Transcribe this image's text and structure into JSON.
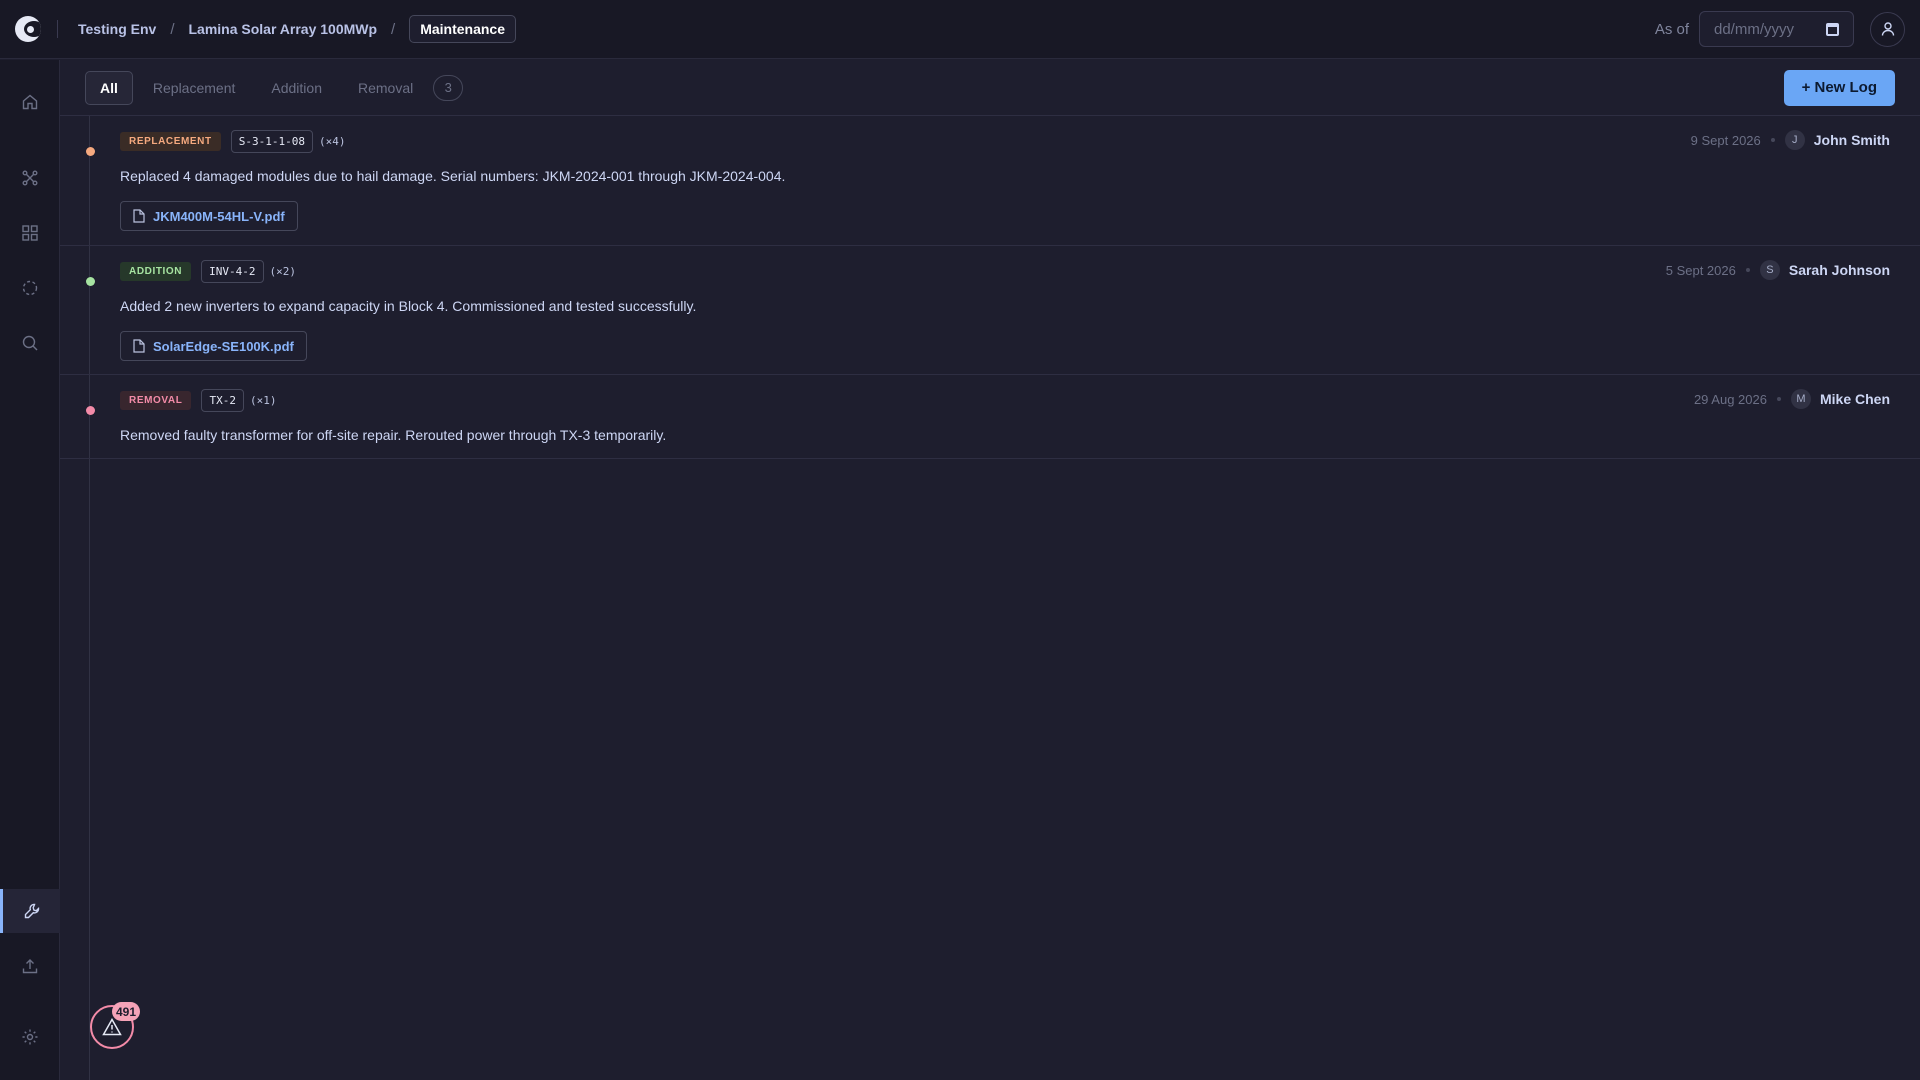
{
  "breadcrumb": {
    "items": [
      "Testing Env",
      "Lamina Solar Array 100MWp"
    ],
    "active": "Maintenance"
  },
  "header": {
    "as_of_label": "As of",
    "date_placeholder": "dd/mm/yyyy"
  },
  "tabs": {
    "all": "All",
    "replacement": "Replacement",
    "addition": "Addition",
    "removal": "Removal",
    "count": "3"
  },
  "new_log_label": "+ New Log",
  "logs": [
    {
      "type": "REPLACEMENT",
      "code": "S-3-1-1-08",
      "multiplier": "(×4)",
      "description": "Replaced 4 damaged modules due to hail damage. Serial numbers: JKM-2024-001 through JKM-2024-004.",
      "file": "JKM400M-54HL-V.pdf",
      "date": "9 Sept 2026",
      "user_initial": "J",
      "user": "John Smith",
      "color": "#f5a97f"
    },
    {
      "type": "ADDITION",
      "code": "INV-4-2",
      "multiplier": "(×2)",
      "description": "Added 2 new inverters to expand capacity in Block 4. Commissioned and tested successfully.",
      "file": "SolarEdge-SE100K.pdf",
      "date": "5 Sept 2026",
      "user_initial": "S",
      "user": "Sarah Johnson",
      "color": "#a6e3a1"
    },
    {
      "type": "REMOVAL",
      "code": "TX-2",
      "multiplier": "(×1)",
      "description": "Removed faulty transformer for off-site repair. Rerouted power through TX-3 temporarily.",
      "date": "29 Aug 2026",
      "user_initial": "M",
      "user": "Mike Chen",
      "color": "#f38ba8"
    }
  ],
  "alerts": {
    "count": "491"
  },
  "sidebar": {
    "icons": [
      "home-icon",
      "network-icon",
      "grid-icon",
      "loading-icon",
      "search-icon",
      "wrench-icon",
      "upload-icon",
      "gear-icon"
    ]
  }
}
